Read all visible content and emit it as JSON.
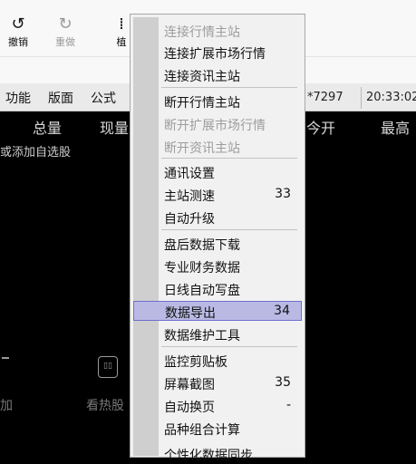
{
  "toolbar": {
    "undo_label": "撤销",
    "redo_label": "重做",
    "partial_button_label": "植"
  },
  "menubar": {
    "items": [
      "功能",
      "版面",
      "公式"
    ]
  },
  "status": {
    "account": "*7297",
    "time": "20:33:02"
  },
  "quote_header": {
    "columns": [
      "总量",
      "现量",
      "今开",
      "最高"
    ]
  },
  "watchlist": {
    "hint": "或添加自选股",
    "bottom_left_label": "加",
    "hot_stock_label": "看热股"
  },
  "context_menu": {
    "items": [
      {
        "label": "连接行情主站",
        "disabled": true
      },
      {
        "label": "连接扩展市场行情",
        "disabled": false
      },
      {
        "label": "连接资讯主站",
        "disabled": false
      },
      {
        "label": "断开行情主站",
        "disabled": false
      },
      {
        "label": "断开扩展市场行情",
        "disabled": true
      },
      {
        "label": "断开资讯主站",
        "disabled": true
      },
      {
        "label": "通讯设置",
        "disabled": false
      },
      {
        "label": "主站测速",
        "shortcut": "33",
        "disabled": false
      },
      {
        "label": "自动升级",
        "disabled": false
      },
      {
        "label": "盘后数据下载",
        "disabled": false
      },
      {
        "label": "专业财务数据",
        "disabled": false
      },
      {
        "label": "日线自动写盘",
        "disabled": false
      },
      {
        "label": "数据导出",
        "shortcut": "34",
        "disabled": false,
        "selected": true
      },
      {
        "label": "数据维护工具",
        "disabled": false
      },
      {
        "label": "监控剪贴板",
        "disabled": false
      },
      {
        "label": "屏幕截图",
        "shortcut": "35",
        "disabled": false
      },
      {
        "label": "自动换页",
        "shortcut": "-",
        "disabled": false
      },
      {
        "label": "品种组合计算",
        "disabled": false
      },
      {
        "label": "个性化数据同步",
        "disabled": false
      }
    ]
  },
  "icons": {
    "undo": "undo-icon",
    "redo": "redo-icon",
    "hot_stock": "hot-stock-icon"
  }
}
